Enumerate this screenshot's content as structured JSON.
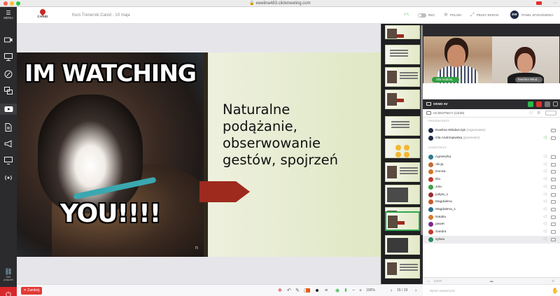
{
  "browser": {
    "url": "ewelina483.clickmeeting.com"
  },
  "sidebar": {
    "menu_label": "MENU",
    "items": [
      "camera-icon",
      "presentation-icon",
      "whiteboard-icon",
      "screen-share-icon",
      "youtube-icon",
      "files-icon",
      "megaphone-icon",
      "monitor-icon",
      "broadcast-icon"
    ],
    "bottom_label": "Sieć połączeń"
  },
  "header": {
    "logo_text": "CANID",
    "title": "Kurs Trenerski Canid - 10 maja",
    "rec": "REC",
    "language": "POLSKI",
    "fullscreen": "PEŁNY EKRAN",
    "avatar": "EW",
    "panel": "PANEL WYDARZENIA"
  },
  "slide": {
    "meme_top": "IM WATCHING",
    "meme_bottom": "YOU!!!!",
    "photo_mark": "n",
    "lines": [
      "Naturalne",
      "podążanie,",
      "obserwowanie",
      "gestów, spojrzeń"
    ]
  },
  "video": {
    "label_1": "Ola Andrzej...",
    "label_2": "Ewelina Włod..."
  },
  "av_window": {
    "label": "OKNO AV"
  },
  "participants": {
    "header": "UCZESTNICY (13/29)",
    "section_presenters": "PREZENTERZY",
    "section_participants": "UCZESTNICY",
    "presenters": [
      {
        "name": "Ewelina Włodarczyk",
        "role": "(organizator)",
        "initials": "EW"
      },
      {
        "name": "Ola Andrzejewska",
        "role": "(prezenter)",
        "initials": "OA"
      }
    ],
    "list": [
      {
        "name": "Agnieszka"
      },
      {
        "name": "Alicja"
      },
      {
        "name": "Dorota"
      },
      {
        "name": "Ela"
      },
      {
        "name": "Jola"
      },
      {
        "name": "judyta_1"
      },
      {
        "name": "Magdalena"
      },
      {
        "name": "Magdalena_1"
      },
      {
        "name": "Natalia"
      },
      {
        "name": "paweł"
      },
      {
        "name": "Sandra"
      },
      {
        "name": "sylwia"
      }
    ],
    "colors": [
      "#1f2a44",
      "#1f2a44",
      "#2a7d8c",
      "#c46a2d",
      "#d0782a",
      "#c0392b",
      "#3aa34a",
      "#9b2d2d",
      "#c85a2a",
      "#2a6d8c",
      "#d47a2a",
      "#7a2a8c",
      "#c0392b",
      "#2a8c5a"
    ]
  },
  "chat": {
    "label": "CZAT",
    "placeholder": "Wpisz wiadomość"
  },
  "toolbar": {
    "close_label": "Zamknij",
    "zoom": "100%",
    "page": "15 / 19"
  }
}
